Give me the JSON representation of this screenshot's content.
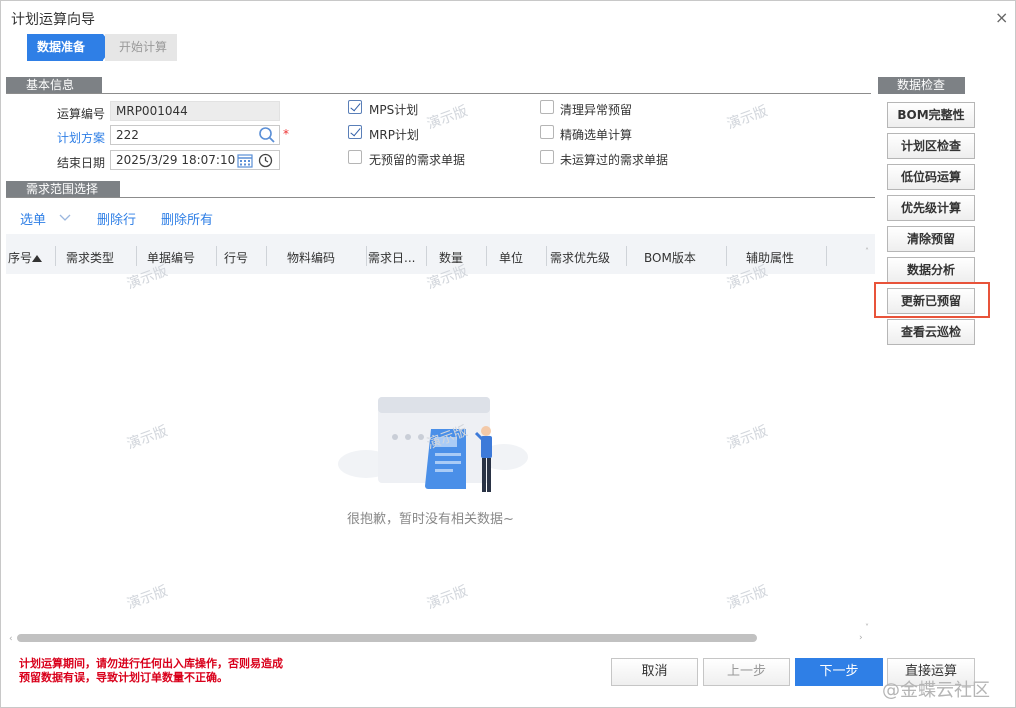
{
  "window": {
    "title": "计划运算向导",
    "close": "×"
  },
  "steps": [
    "数据准备",
    "开始计算"
  ],
  "sections": {
    "basic": "基本信息",
    "demand": "需求范围选择",
    "check": "数据检查"
  },
  "form": {
    "calc_no_label": "运算编号",
    "calc_no_value": "MRP001044",
    "plan_label": "计划方案",
    "plan_value": "222",
    "required": "*",
    "end_date_label": "结束日期",
    "end_date_value": "2025/3/29 18:07:10"
  },
  "checkboxes": [
    {
      "label": "MPS计划",
      "checked": true
    },
    {
      "label": "MRP计划",
      "checked": true
    },
    {
      "label": "无预留的需求单据",
      "checked": false
    },
    {
      "label": "清理异常预留",
      "checked": false
    },
    {
      "label": "精确选单计算",
      "checked": false
    },
    {
      "label": "未运算过的需求单据",
      "checked": false
    }
  ],
  "toolbar": {
    "select": "选单",
    "delete_row": "删除行",
    "delete_all": "删除所有"
  },
  "table": {
    "columns": [
      "序号",
      "需求类型",
      "单据编号",
      "行号",
      "物料编码",
      "需求日...",
      "数量",
      "单位",
      "需求优先级",
      "BOM版本",
      "辅助属性"
    ]
  },
  "empty_text": "很抱歉，暂时没有相关数据~",
  "side_buttons": [
    "BOM完整性",
    "计划区检查",
    "低位码运算",
    "优先级计算",
    "清除预留",
    "数据分析",
    "更新已预留",
    "查看云巡检"
  ],
  "highlight_color": "#e8533a",
  "warning": [
    "计划运算期间，请勿进行任何出入库操作，否则易造成",
    "预留数据有误，导致计划订单数量不正确。"
  ],
  "buttons": {
    "cancel": "取消",
    "prev": "上一步",
    "next": "下一步",
    "direct": "直接运算"
  },
  "watermark": "演示版",
  "footer_brand": "@金蝶云社区"
}
